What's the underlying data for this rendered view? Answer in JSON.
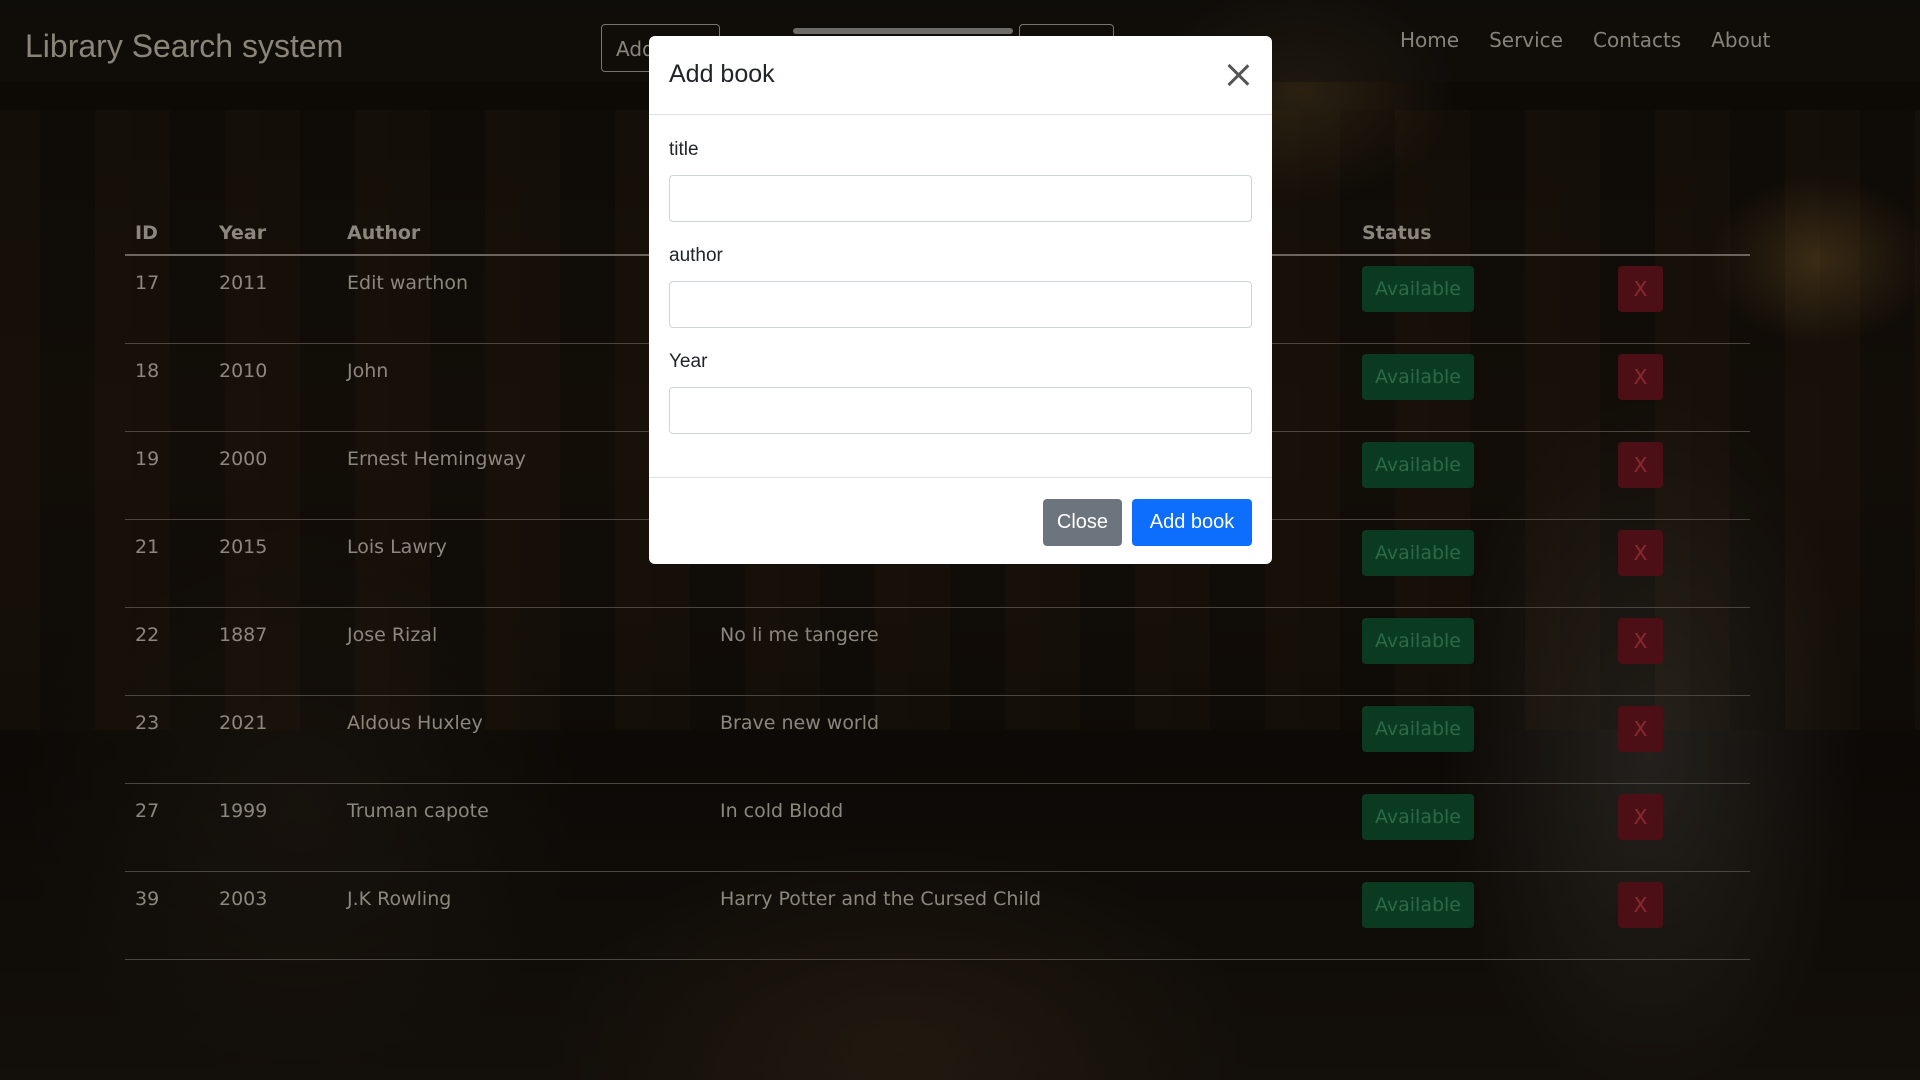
{
  "navbar": {
    "brand": "Library Search system",
    "search_button_label": "Add",
    "links": [
      "Home",
      "Service",
      "Contacts",
      "About"
    ]
  },
  "table": {
    "headers": {
      "id": "ID",
      "year": "Year",
      "author": "Author",
      "title": "",
      "status": "Status"
    },
    "rows": [
      {
        "id": "17",
        "year": "2011",
        "author": "Edit warthon",
        "title": "",
        "status": "Available",
        "delete": "X"
      },
      {
        "id": "18",
        "year": "2010",
        "author": "John",
        "title": "",
        "status": "Available",
        "delete": "X"
      },
      {
        "id": "19",
        "year": "2000",
        "author": "Ernest Hemingway",
        "title": "",
        "status": "Available",
        "delete": "X"
      },
      {
        "id": "21",
        "year": "2015",
        "author": "Lois Lawry",
        "title": "",
        "status": "Available",
        "delete": "X"
      },
      {
        "id": "22",
        "year": "1887",
        "author": "Jose Rizal",
        "title": "No li me tangere",
        "status": "Available",
        "delete": "X"
      },
      {
        "id": "23",
        "year": "2021",
        "author": "Aldous Huxley",
        "title": "Brave new world",
        "status": "Available",
        "delete": "X"
      },
      {
        "id": "27",
        "year": "1999",
        "author": "Truman capote",
        "title": "In cold Blodd",
        "status": "Available",
        "delete": "X"
      },
      {
        "id": "39",
        "year": "2003",
        "author": "J.K Rowling",
        "title": "Harry Potter and the Cursed Child",
        "status": "Available",
        "delete": "X"
      }
    ]
  },
  "modal": {
    "title": "Add book",
    "fields": [
      {
        "label": "title",
        "value": "",
        "placeholder": ""
      },
      {
        "label": "author",
        "value": "",
        "placeholder": ""
      },
      {
        "label": "Year",
        "value": "",
        "placeholder": ""
      }
    ],
    "close_label": "Close",
    "submit_label": "Add book",
    "close_icon": "close-icon"
  },
  "colors": {
    "primary": "#0d6efd",
    "secondary": "#6c757d",
    "success": "#198754",
    "danger": "#dc3545"
  }
}
